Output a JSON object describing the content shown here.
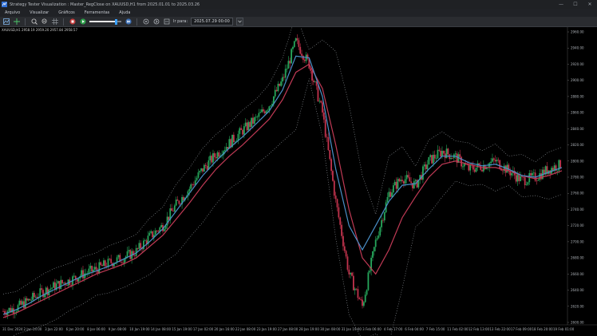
{
  "window": {
    "title": "Strategy Tester Visualization : Master_RegClose on XAUUSD,H1 from 2025.01.01 to 2025.03.26",
    "controls": [
      "—",
      "☐",
      "✕"
    ]
  },
  "menu": [
    "Arquivo",
    "Visualizar",
    "Gráficos",
    "Ferramentas",
    "Ajuda"
  ],
  "toolbar": {
    "speed_label": "Ir para:",
    "goto_date": "2025.07.29 00:00",
    "icons": [
      "chart-icon",
      "crosshair-icon",
      "zoom-in-icon",
      "zoom-out-icon",
      "grid-icon",
      "stop-icon",
      "play-icon",
      "skip-icon"
    ]
  },
  "chart_info": "XAUUSD,H1  2958.19 2959.20 2957.84 2958.57",
  "colors": {
    "bull": "#26a65b",
    "bear": "#c2334d",
    "fast_line": "#4a90c8",
    "slow_line": "#c03a55",
    "band": "#9aa0a6"
  },
  "chart_data": {
    "type": "line",
    "x_labels": [
      "31 Dec 2024",
      "2 Jan 14:00",
      "3 Jan 22:00",
      "6 Jan 20:00",
      "8 Jan 06:00",
      "9 Jan 08:00",
      "10 Jan 19:00",
      "14 Jan 08:00",
      "15 Jan 19:00",
      "17 Jan 02:00",
      "20 Jan 16:00",
      "22 Jan 08:00",
      "23 Jan 19:00",
      "27 Jan 08:00",
      "28 Jan 19:00",
      "30 Jan 08:00",
      "31 Jan 19:00",
      "3 Feb 06:00",
      "4 Feb 17:00",
      "6 Feb 04:00",
      "7 Feb 15:00",
      "11 Feb 02:00",
      "12 Feb 13:00",
      "13 Feb 22:00",
      "17 Feb 09:00",
      "18 Feb 20:00",
      "19 Feb 01:00"
    ],
    "price_min": 2600,
    "price_max": 2960,
    "close": [
      2614,
      2618,
      2628,
      2638,
      2646,
      2652,
      2660,
      2666,
      2674,
      2680,
      2688,
      2706,
      2720,
      2746,
      2766,
      2790,
      2808,
      2822,
      2838,
      2852,
      2870,
      2900,
      2948,
      2920,
      2860,
      2750,
      2660,
      2620,
      2700,
      2760,
      2780,
      2770,
      2800,
      2812,
      2805,
      2790,
      2794,
      2800,
      2788,
      2776,
      2780,
      2790,
      2796
    ],
    "fast_ma": [
      2610,
      2616,
      2624,
      2634,
      2642,
      2650,
      2658,
      2664,
      2670,
      2678,
      2686,
      2700,
      2716,
      2738,
      2760,
      2782,
      2800,
      2816,
      2830,
      2846,
      2862,
      2888,
      2930,
      2928,
      2880,
      2790,
      2720,
      2690,
      2720,
      2750,
      2770,
      2772,
      2790,
      2806,
      2806,
      2798,
      2794,
      2796,
      2790,
      2782,
      2780,
      2786,
      2792
    ],
    "slow_ma": [
      2606,
      2612,
      2620,
      2628,
      2636,
      2644,
      2652,
      2660,
      2666,
      2672,
      2680,
      2694,
      2708,
      2728,
      2748,
      2770,
      2790,
      2806,
      2820,
      2836,
      2852,
      2876,
      2910,
      2920,
      2890,
      2820,
      2740,
      2680,
      2660,
      2690,
      2730,
      2756,
      2780,
      2796,
      2800,
      2796,
      2792,
      2792,
      2788,
      2782,
      2778,
      2782,
      2788
    ]
  }
}
